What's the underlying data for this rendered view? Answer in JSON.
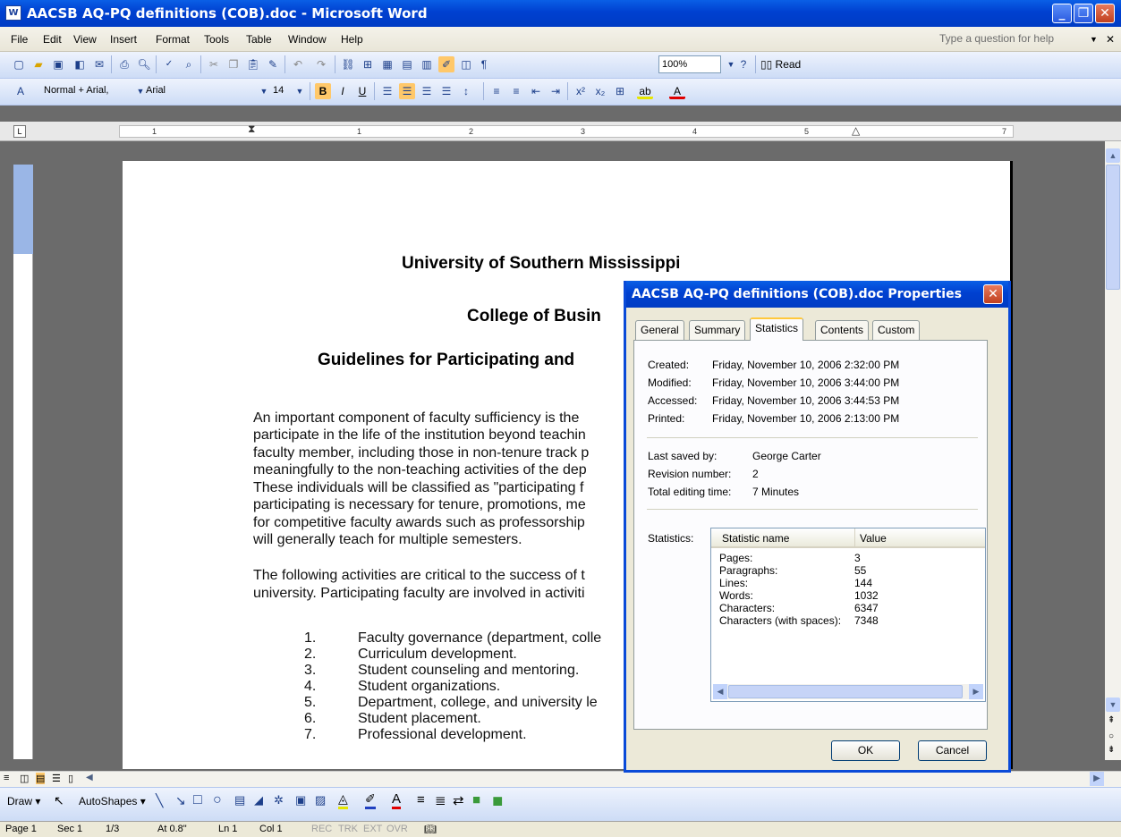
{
  "window": {
    "title": "AACSB AQ-PQ definitions (COB).doc - Microsoft Word",
    "app_icon": "word-doc-icon"
  },
  "menu": {
    "items": [
      "File",
      "Edit",
      "View",
      "Insert",
      "Format",
      "Tools",
      "Table",
      "Window",
      "Help"
    ],
    "help_placeholder": "Type a question for help"
  },
  "standard_toolbar": {
    "zoom": "100%",
    "read_label": "Read"
  },
  "formatting_toolbar": {
    "style": "Normal + Arial,",
    "font": "Arial",
    "size": "14"
  },
  "ruler": {
    "numbers": [
      "1",
      "1",
      "2",
      "3",
      "4",
      "5",
      "7"
    ]
  },
  "document": {
    "title_line1": "University of Southern Mississippi",
    "title_line2": "College of Busin",
    "title_line3": "Guidelines for Participating and",
    "para1": [
      "An important component of faculty sufficiency is the",
      "participate in the life of the institution beyond teachin",
      "faculty member, including those in non-tenure track p",
      "meaningfully to the non-teaching activities of the dep",
      "These individuals will be classified as \"participating f",
      "participating is necessary for tenure, promotions, me",
      "for competitive faculty awards such as professorship",
      "will generally teach for multiple semesters."
    ],
    "para2": [
      "The following activities are critical to the success of t",
      "university. Participating faculty are involved in activiti"
    ],
    "list": [
      {
        "num": "1.",
        "text": "Faculty governance (department, colle"
      },
      {
        "num": "2.",
        "text": "Curriculum development."
      },
      {
        "num": "3.",
        "text": "Student counseling and mentoring."
      },
      {
        "num": "4.",
        "text": "Student organizations."
      },
      {
        "num": "5.",
        "text": "Department, college, and university le"
      },
      {
        "num": "6.",
        "text": "Student placement."
      },
      {
        "num": "7.",
        "text": "Professional development."
      }
    ]
  },
  "dialog": {
    "title": "AACSB AQ-PQ definitions (COB).doc Properties",
    "tabs": [
      "General",
      "Summary",
      "Statistics",
      "Contents",
      "Custom"
    ],
    "active_tab": "Statistics",
    "dates": [
      {
        "label": "Created:",
        "value": "Friday, November 10, 2006 2:32:00 PM"
      },
      {
        "label": "Modified:",
        "value": "Friday, November 10, 2006 3:44:00 PM"
      },
      {
        "label": "Accessed:",
        "value": "Friday, November 10, 2006 3:44:53 PM"
      },
      {
        "label": "Printed:",
        "value": "Friday, November 10, 2006 2:13:00 PM"
      }
    ],
    "last_saved_label": "Last saved by:",
    "last_saved_value": "George Carter",
    "revision_label": "Revision number:",
    "revision_value": "2",
    "editing_label": "Total editing time:",
    "editing_value": "7 Minutes",
    "statistics_label": "Statistics:",
    "columns": [
      "Statistic name",
      "Value"
    ],
    "rows": [
      {
        "name": "Pages:",
        "value": "3"
      },
      {
        "name": "Paragraphs:",
        "value": "55"
      },
      {
        "name": "Lines:",
        "value": "144"
      },
      {
        "name": "Words:",
        "value": "1032"
      },
      {
        "name": "Characters:",
        "value": "6347"
      },
      {
        "name": "Characters (with spaces):",
        "value": "7348"
      }
    ],
    "ok_label": "OK",
    "cancel_label": "Cancel"
  },
  "drawing_toolbar": {
    "draw_label": "Draw",
    "autoshapes_label": "AutoShapes"
  },
  "status": {
    "page": "Page 1",
    "sec": "Sec 1",
    "of": "1/3",
    "at": "At 0.8\"",
    "ln": "Ln 1",
    "col": "Col 1",
    "rec": "REC",
    "trk": "TRK",
    "ext": "EXT",
    "ovr": "OVR"
  },
  "colors": {
    "titlebar": "#0040d0",
    "toolbar": "#cddcf6",
    "dialog_bg": "#ece9d8"
  }
}
